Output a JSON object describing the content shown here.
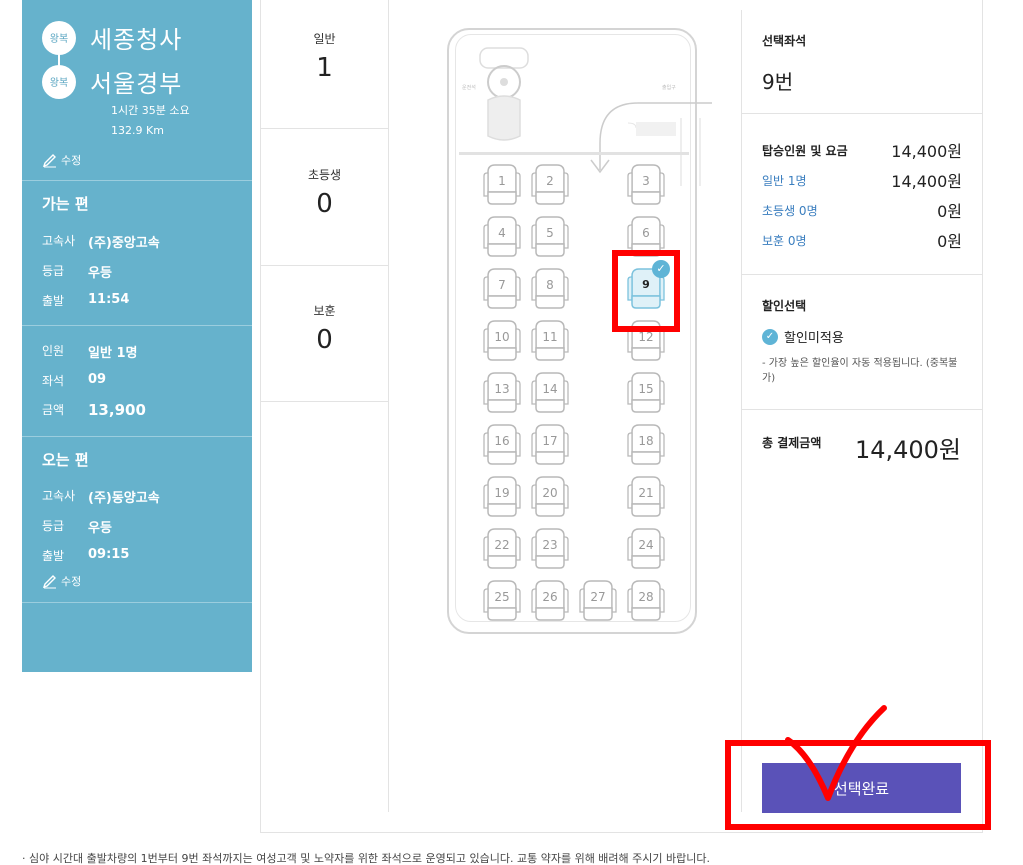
{
  "route": {
    "badge_label": "왕복",
    "origin": "세종청사",
    "destination": "서울경부",
    "duration": "1시간 35분 소요",
    "distance": "132.9 Km",
    "edit_label": "수정"
  },
  "outbound": {
    "title": "가는 편",
    "rows": [
      {
        "key": "고속사",
        "value": "(주)중앙고속"
      },
      {
        "key": "등급",
        "value": "우등"
      },
      {
        "key": "출발",
        "value": "11:54"
      }
    ]
  },
  "booking": {
    "rows": [
      {
        "key": "인원",
        "value": "일반 1명"
      },
      {
        "key": "좌석",
        "value": "09"
      },
      {
        "key": "금액",
        "value": "13,900"
      }
    ]
  },
  "return_trip": {
    "title": "오는 편",
    "rows": [
      {
        "key": "고속사",
        "value": "(주)동양고속"
      },
      {
        "key": "등급",
        "value": "우등"
      },
      {
        "key": "출발",
        "value": "09:15"
      }
    ],
    "edit_label": "수정"
  },
  "passenger_counts": [
    {
      "label": "일반",
      "count": "1"
    },
    {
      "label": "초등생",
      "count": "0"
    },
    {
      "label": "보훈",
      "count": "0"
    }
  ],
  "bus": {
    "driver_label": "운전석",
    "entrance_label": "출입구",
    "seats": [
      {
        "no": "1",
        "selected": false
      },
      {
        "no": "2",
        "selected": false
      },
      {
        "no": "3",
        "selected": false
      },
      {
        "no": "4",
        "selected": false
      },
      {
        "no": "5",
        "selected": false
      },
      {
        "no": "6",
        "selected": false
      },
      {
        "no": "7",
        "selected": false
      },
      {
        "no": "8",
        "selected": false
      },
      {
        "no": "9",
        "selected": true
      },
      {
        "no": "10",
        "selected": false
      },
      {
        "no": "11",
        "selected": false
      },
      {
        "no": "12",
        "selected": false
      },
      {
        "no": "13",
        "selected": false
      },
      {
        "no": "14",
        "selected": false
      },
      {
        "no": "15",
        "selected": false
      },
      {
        "no": "16",
        "selected": false
      },
      {
        "no": "17",
        "selected": false
      },
      {
        "no": "18",
        "selected": false
      },
      {
        "no": "19",
        "selected": false
      },
      {
        "no": "20",
        "selected": false
      },
      {
        "no": "21",
        "selected": false
      },
      {
        "no": "22",
        "selected": false
      },
      {
        "no": "23",
        "selected": false
      },
      {
        "no": "24",
        "selected": false
      },
      {
        "no": "25",
        "selected": false
      },
      {
        "no": "26",
        "selected": false
      },
      {
        "no": "27",
        "selected": false
      },
      {
        "no": "28",
        "selected": false
      }
    ]
  },
  "summary": {
    "selected_seat_title": "선택좌석",
    "selected_seat_value": "9번",
    "fare_title": "탑승인원 및 요금",
    "fare_total": "14,400원",
    "fare_rows": [
      {
        "key": "일반 1명",
        "value": "14,400원"
      },
      {
        "key": "초등생 0명",
        "value": "0원"
      },
      {
        "key": "보훈 0명",
        "value": "0원"
      }
    ],
    "discount_title": "할인선택",
    "discount_option": "할인미적용",
    "discount_note": "- 가장 높은 할인율이 자동 적용됩니다. (중복불가)",
    "total_label": "총 결제금액",
    "total_value": "14,400원",
    "confirm_label": "선택완료"
  },
  "footnote": "· 심야 시간대 출발차량의 1번부터 9번 좌석까지는 여성고객 및 노약자를 위한 좌석으로 운영되고 있습니다. 교통 약자를 위해 배려해 주시기 바랍니다.",
  "colors": {
    "panel": "#66b2cc",
    "confirm_button": "#5a52b8",
    "selected_seat": "#5fb4d6",
    "annotation": "#ff0000"
  }
}
